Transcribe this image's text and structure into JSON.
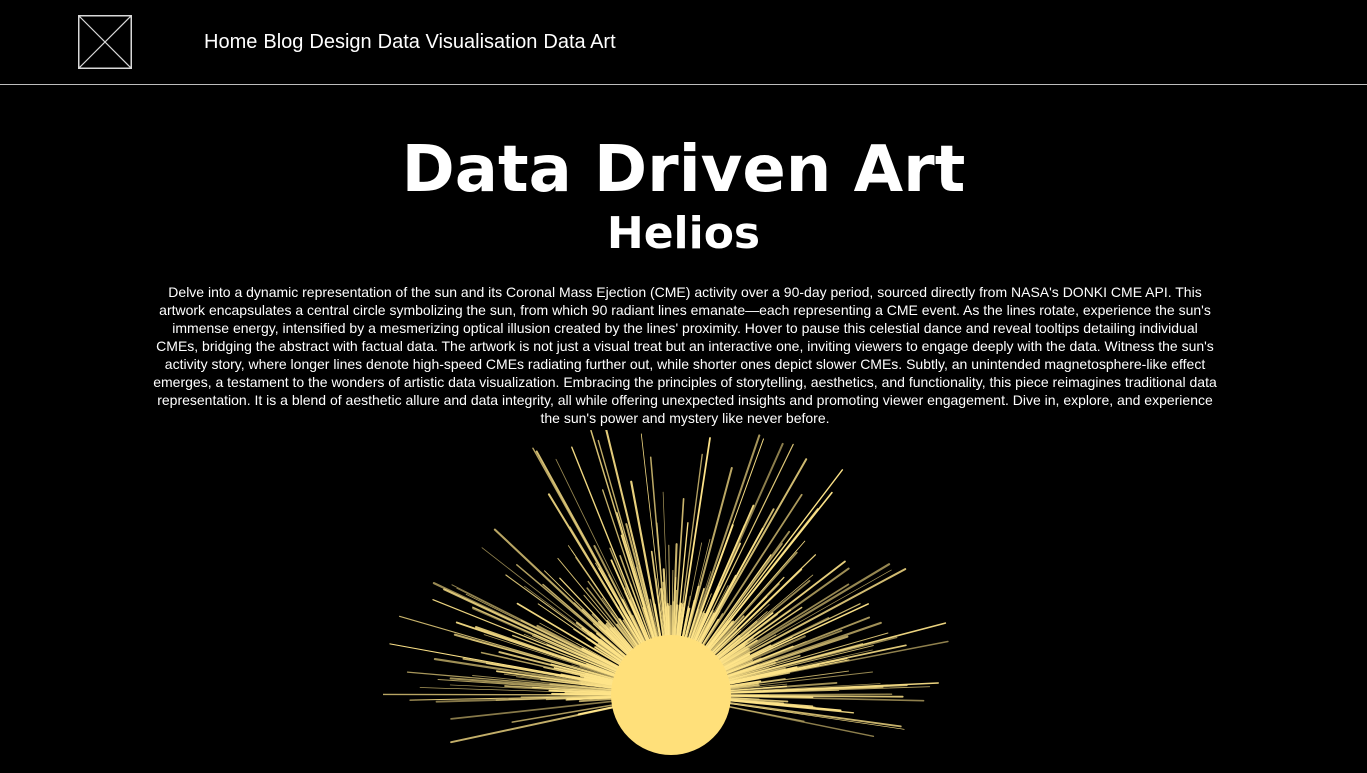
{
  "header": {
    "nav": [
      {
        "label": "Home"
      },
      {
        "label": "Blog"
      },
      {
        "label": "Design"
      },
      {
        "label": "Data Visualisation"
      },
      {
        "label": "Data Art"
      }
    ]
  },
  "main": {
    "title": "Data Driven Art",
    "subtitle": "Helios",
    "description": "Delve into a dynamic representation of the sun and its Coronal Mass Ejection (CME) activity over a 90-day period, sourced directly from NASA's DONKI CME API. This artwork encapsulates a central circle symbolizing the sun, from which 90 radiant lines emanate—each representing a CME event. As the lines rotate, experience the sun's immense energy, intensified by a mesmerizing optical illusion created by the lines' proximity. Hover to pause this celestial dance and reveal tooltips detailing individual CMEs, bridging the abstract with factual data. The artwork is not just a visual treat but an interactive one, inviting viewers to engage deeply with the data. Witness the sun's activity story, where longer lines denote high-speed CMEs radiating further out, while shorter ones depict slower CMEs. Subtly, an unintended magnetosphere-like effect emerges, a testament to the wonders of artistic data visualization. Embracing the principles of storytelling, aesthetics, and functionality, this piece reimagines traditional data representation. It is a blend of aesthetic allure and data integrity, all while offering unexpected insights and promoting viewer engagement. Dive in, explore, and experience the sun's power and mystery like never before."
  },
  "artwork": {
    "sun_color": "#FFE07A",
    "ray_color": "#FFE58A",
    "background": "#000000",
    "ray_count": 90
  }
}
